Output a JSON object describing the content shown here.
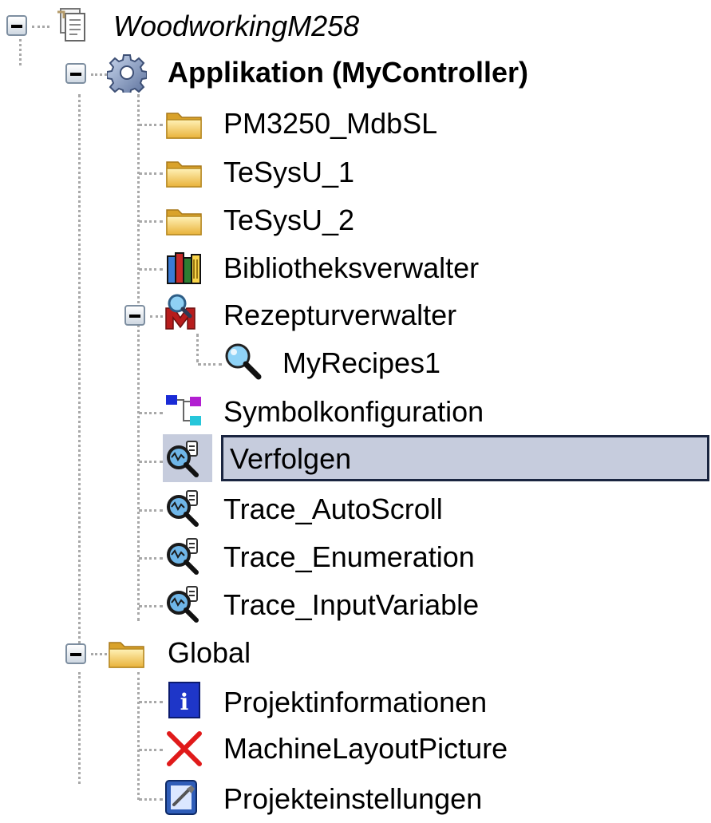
{
  "tree": {
    "root": {
      "label": "WoodworkingM258",
      "icon": "project-document-icon",
      "expanded": true
    },
    "application": {
      "label": "Applikation (MyController)",
      "icon": "gear-icon",
      "expanded": true
    },
    "app_items": [
      {
        "label": "PM3250_MdbSL",
        "icon": "folder-icon"
      },
      {
        "label": "TeSysU_1",
        "icon": "folder-icon"
      },
      {
        "label": "TeSysU_2",
        "icon": "folder-icon"
      },
      {
        "label": "Bibliotheksverwalter",
        "icon": "library-books-icon"
      },
      {
        "label": "Rezepturverwalter",
        "icon": "recipe-manager-icon",
        "expanded": true
      },
      {
        "label": "MyRecipes1",
        "icon": "magnifier-icon"
      },
      {
        "label": "Symbolkonfiguration",
        "icon": "symbol-configuration-icon"
      },
      {
        "label": "Verfolgen",
        "icon": "trace-icon",
        "selected": true
      },
      {
        "label": "Trace_AutoScroll",
        "icon": "trace-icon"
      },
      {
        "label": "Trace_Enumeration",
        "icon": "trace-icon"
      },
      {
        "label": "Trace_InputVariable",
        "icon": "trace-icon"
      }
    ],
    "global": {
      "label": "Global",
      "icon": "folder-icon",
      "expanded": true
    },
    "global_items": [
      {
        "label": "Projektinformationen",
        "icon": "info-icon"
      },
      {
        "label": "MachineLayoutPicture",
        "icon": "red-x-icon"
      },
      {
        "label": "Projekteinstellungen",
        "icon": "project-settings-icon"
      }
    ]
  },
  "colors": {
    "selection": "#c6ccdd",
    "selection_border": "#1a2540",
    "folder": "#f2c94c",
    "connector": "#a8a8a8"
  }
}
